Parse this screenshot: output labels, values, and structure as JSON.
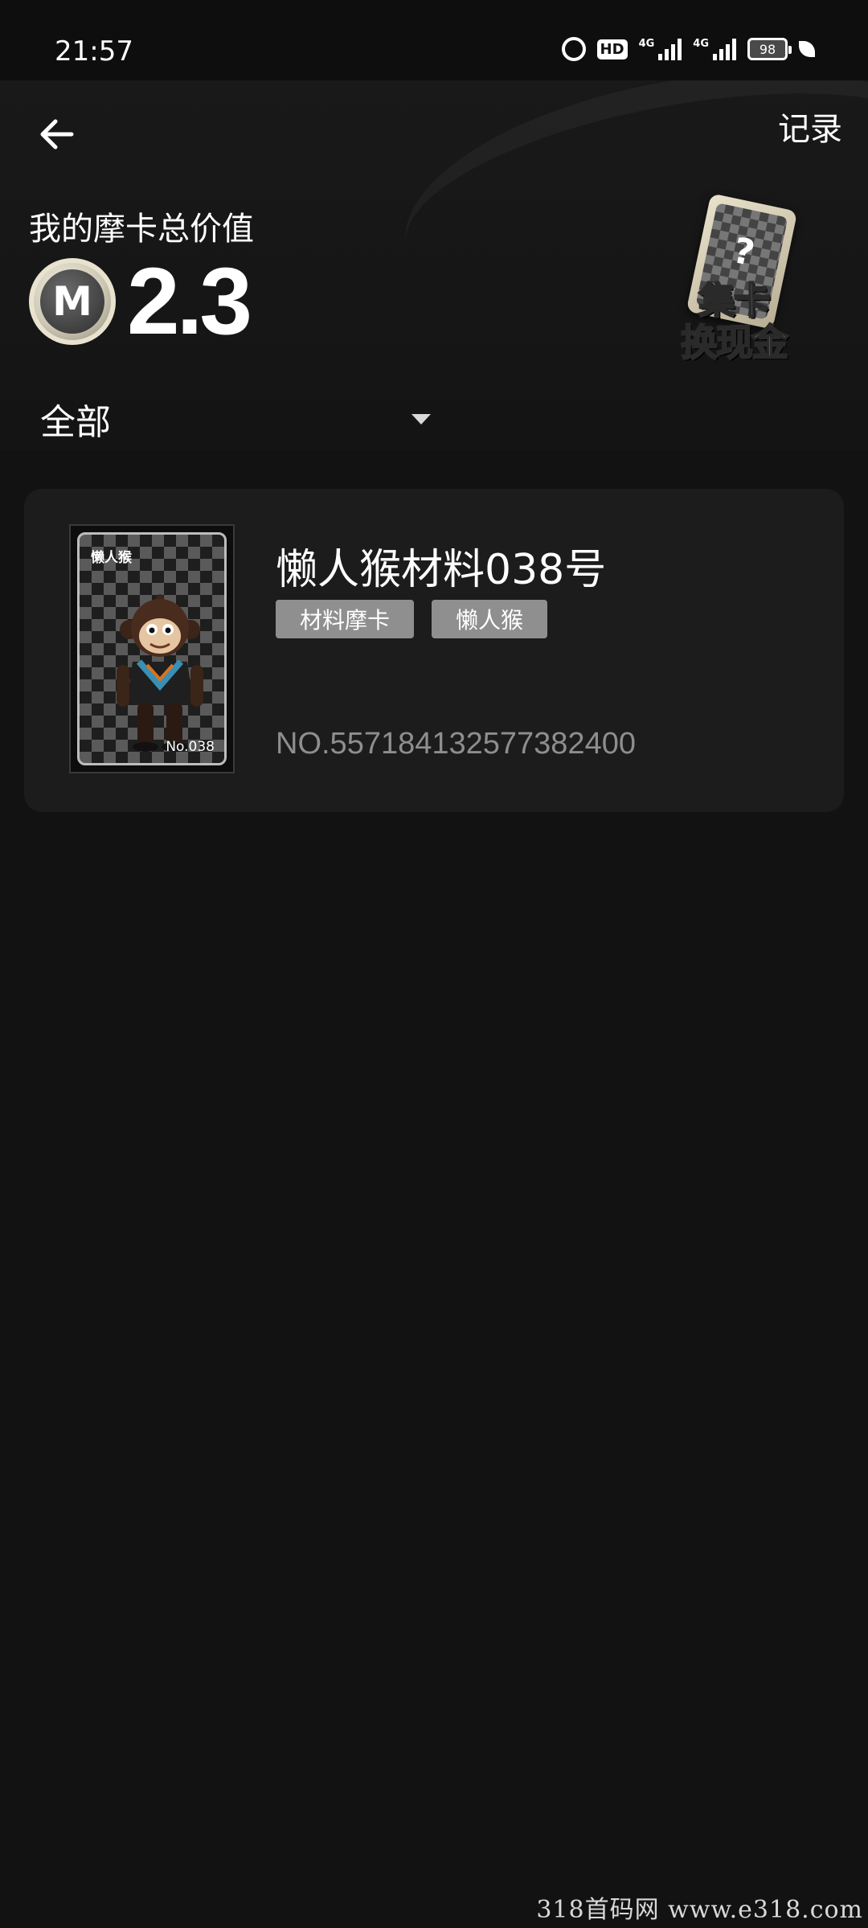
{
  "status_bar": {
    "time": "21:57",
    "hd_label": "HD",
    "net_label_1": "4G",
    "net_label_2": "4G",
    "battery": "98"
  },
  "nav": {
    "records_label": "记录"
  },
  "summary": {
    "label": "我的摩卡总价值",
    "coin_symbol": "M",
    "value": "2.3"
  },
  "promo": {
    "card_symbol": "?",
    "line1": "集卡",
    "line2": "换现金"
  },
  "filter": {
    "selected": "全部"
  },
  "cards": [
    {
      "title": "懒人猴材料038号",
      "tags": [
        "材料摩卡",
        "懒人猴"
      ],
      "serial": "NO.557184132577382400",
      "thumb_tag": "懒人猴",
      "thumb_no": "No.038"
    }
  ],
  "watermark": "318首码网 www.e318.com",
  "colors": {
    "background": "#121212",
    "card_bg": "#1c1c1c",
    "tag_bg": "#8f8f8f",
    "serial_text": "#8e8e8e"
  }
}
